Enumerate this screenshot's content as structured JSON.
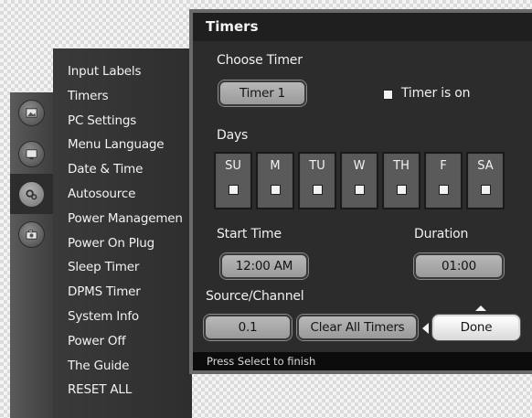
{
  "menu": {
    "items": [
      {
        "label": "Input Labels"
      },
      {
        "label": "Timers"
      },
      {
        "label": "PC Settings"
      },
      {
        "label": "Menu Language"
      },
      {
        "label": "Date & Time"
      },
      {
        "label": "Autosource"
      },
      {
        "label": "Power Managemen"
      },
      {
        "label": "Power On Plug"
      },
      {
        "label": "Sleep Timer"
      },
      {
        "label": "DPMS Timer"
      },
      {
        "label": "System Info"
      },
      {
        "label": "Power Off"
      },
      {
        "label": "The Guide"
      },
      {
        "label": "RESET ALL"
      }
    ]
  },
  "side_icons": [
    {
      "icon": "picture-icon"
    },
    {
      "icon": "tv-icon"
    },
    {
      "icon": "settings-gears-icon",
      "selected": true
    },
    {
      "icon": "camera-icon"
    }
  ],
  "dialog": {
    "title": "Timers",
    "choose_timer_label": "Choose Timer",
    "timer_button_label": "Timer 1",
    "timer_is_on_label": "Timer is on",
    "days_label": "Days",
    "days": [
      "SU",
      "M",
      "TU",
      "W",
      "TH",
      "F",
      "SA"
    ],
    "start_time_label": "Start Time",
    "start_time_value": "12:00 AM",
    "duration_label": "Duration",
    "duration_value": "01:00",
    "source_channel_label": "Source/Channel",
    "channel_value": "0.1",
    "clear_all_label": "Clear All Timers",
    "done_label": "Done",
    "status_text": "Press Select to finish"
  },
  "colors": {
    "panel_dark": "#2c2c2c",
    "header_dark": "#1f1f1f",
    "button_gray": "#a8a8a8",
    "focus_white": "#f4f4f4"
  }
}
